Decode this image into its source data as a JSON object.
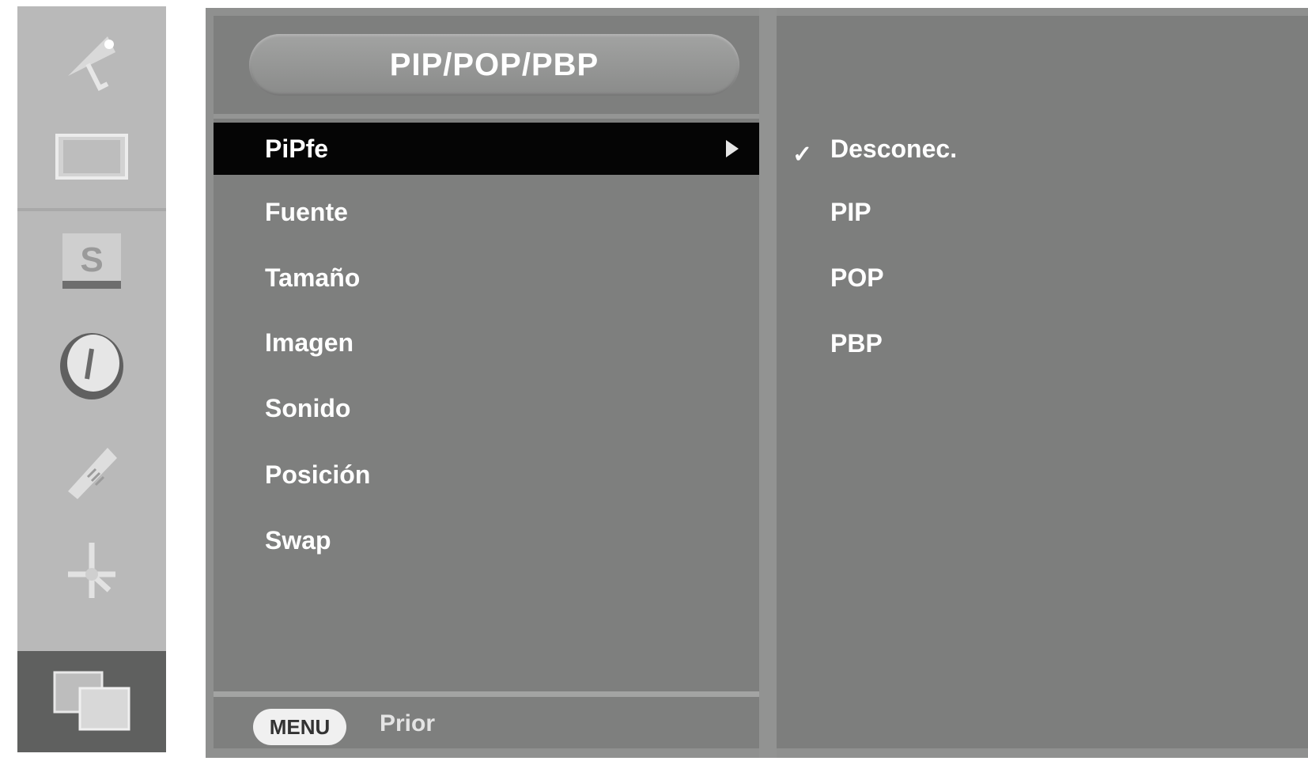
{
  "sidebar": {
    "icons": [
      "satellite-antenna-icon",
      "picture-icon",
      "sound-icon",
      "clock-icon",
      "tools-icon",
      "dpm-icon",
      "pip-icon"
    ],
    "active_index": 6
  },
  "menu": {
    "title": "PIP/POP/PBP",
    "items": [
      {
        "label": "PiPfe",
        "selected": true
      },
      {
        "label": "Fuente",
        "selected": false
      },
      {
        "label": "Tamaño",
        "selected": false
      },
      {
        "label": "Imagen",
        "selected": false
      },
      {
        "label": "Sonido",
        "selected": false
      },
      {
        "label": "Posición",
        "selected": false
      },
      {
        "label": "Swap",
        "selected": false
      }
    ]
  },
  "submenu": {
    "options": [
      {
        "label": "Desconec.",
        "checked": true
      },
      {
        "label": "PIP",
        "checked": false
      },
      {
        "label": "POP",
        "checked": false
      },
      {
        "label": "PBP",
        "checked": false
      }
    ],
    "check_mark": "✓"
  },
  "footer": {
    "button_label": "MENU",
    "action_label": "Prior"
  },
  "colors": {
    "panel": "#8f908f",
    "pane": "#7e7f7e",
    "selected": "#050505",
    "text": "#ffffff"
  }
}
